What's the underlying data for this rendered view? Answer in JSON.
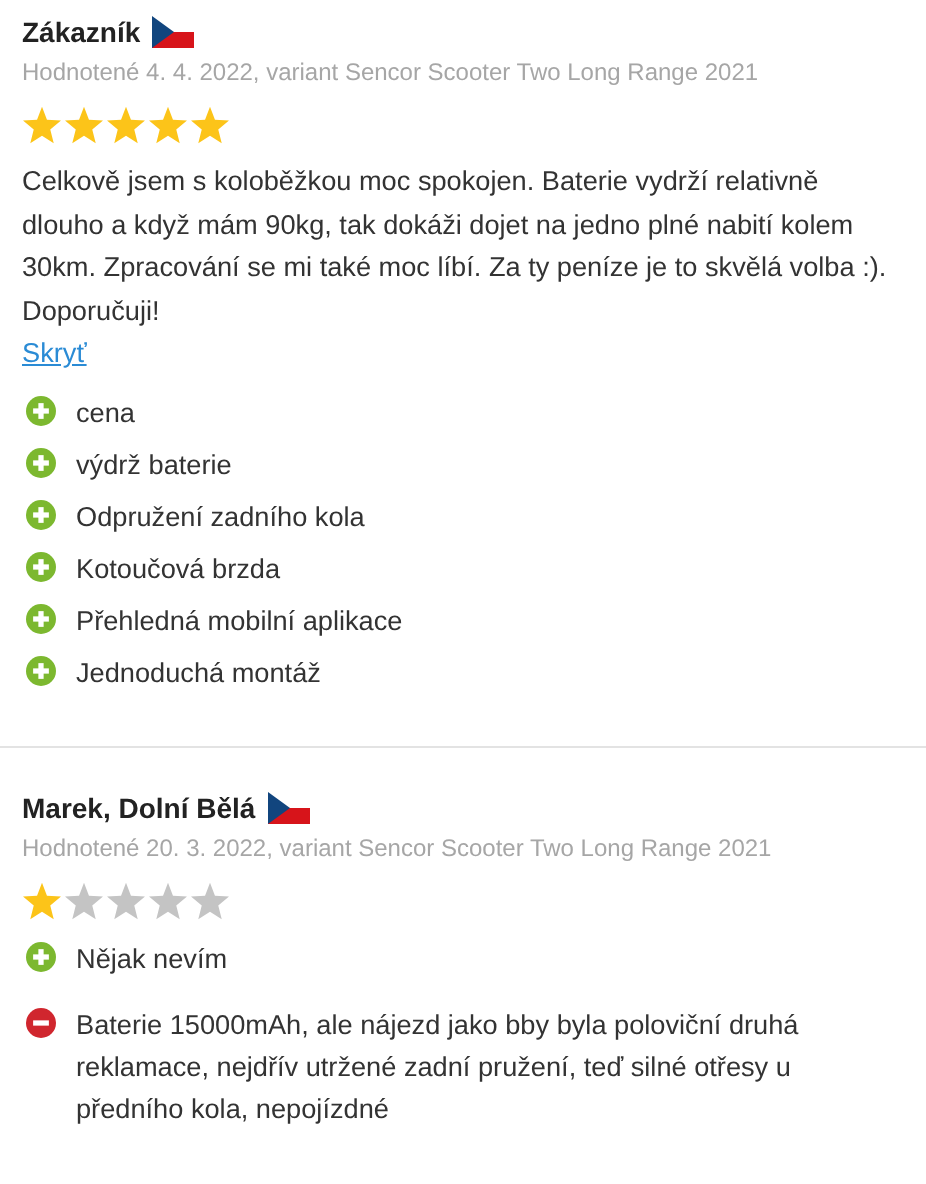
{
  "reviews": [
    {
      "author": "Zákazník",
      "meta": "Hodnotené 4. 4. 2022, variant Sencor Scooter Two Long Range 2021",
      "stars": 5,
      "text": "Celkově jsem s koloběžkou moc spokojen. Baterie vydrží relativně dlouho a když mám 90kg, tak dokáži dojet na jedno plné nabití kolem 30km. Zpracování se mi také moc líbí. Za ty peníze je to skvělá volba :). Doporučuji!",
      "hide_link": "Skryť",
      "points": [
        {
          "kind": "pro",
          "text": "cena"
        },
        {
          "kind": "pro",
          "text": "výdrž baterie"
        },
        {
          "kind": "pro",
          "text": "Odpružení zadního kola"
        },
        {
          "kind": "pro",
          "text": "Kotoučová brzda"
        },
        {
          "kind": "pro",
          "text": "Přehledná mobilní aplikace"
        },
        {
          "kind": "pro",
          "text": "Jednoduchá montáž"
        }
      ]
    },
    {
      "author": "Marek, Dolní Bělá",
      "meta": "Hodnotené 20. 3. 2022, variant Sencor Scooter Two Long Range 2021",
      "stars": 1,
      "points": [
        {
          "kind": "pro",
          "text": "Nějak nevím"
        },
        {
          "kind": "con",
          "text": "Baterie 15000mAh, ale nájezd jako bby byla poloviční druhá reklamace, nejdřív utržené zadní pružení, teď silné otřesy u předního kola, nepojízdné"
        }
      ]
    }
  ]
}
